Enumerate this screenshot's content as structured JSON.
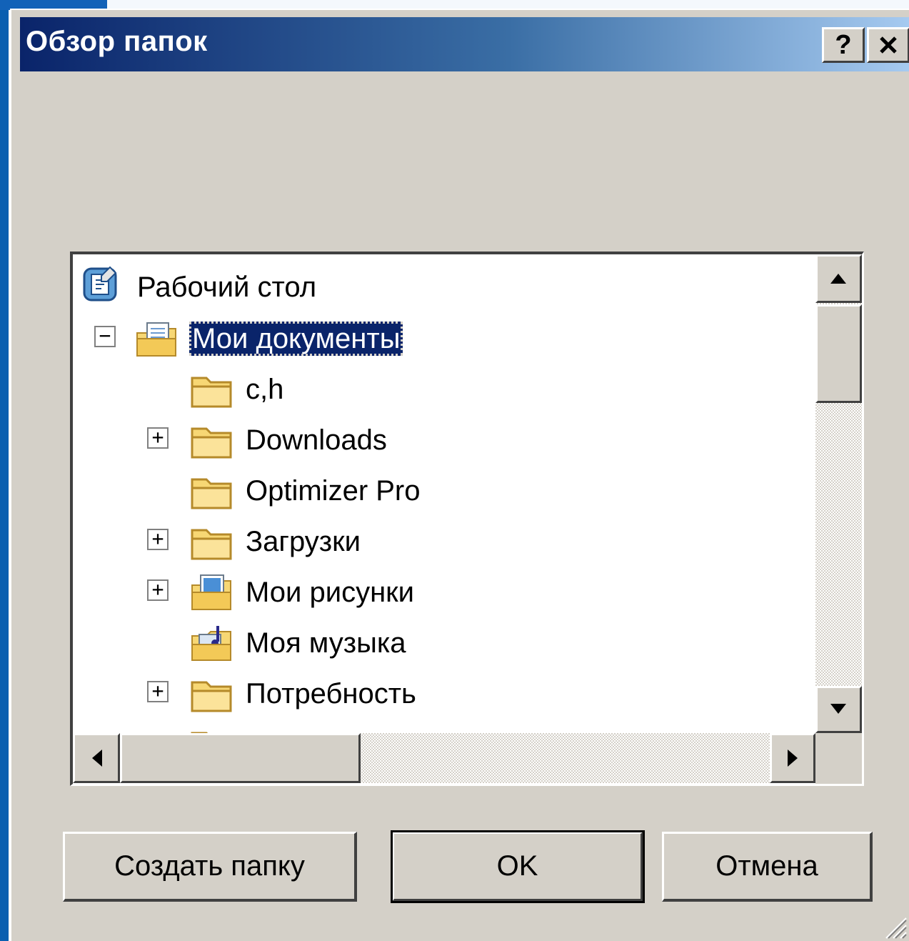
{
  "dialog": {
    "title": "Обзор папок",
    "help_label": "?",
    "close_label": "✕"
  },
  "tree": {
    "root": {
      "label": "Рабочий стол",
      "icon": "desktop-icon"
    },
    "items": [
      {
        "label": "Мои документы",
        "icon": "my-documents-icon",
        "expander": "−",
        "selected": true
      },
      {
        "label": "c,h",
        "icon": "folder-icon",
        "expander": ""
      },
      {
        "label": "Downloads",
        "icon": "folder-icon",
        "expander": "+"
      },
      {
        "label": "Optimizer Pro",
        "icon": "folder-icon",
        "expander": ""
      },
      {
        "label": "Загрузки",
        "icon": "folder-icon",
        "expander": "+"
      },
      {
        "label": "Мои рисунки",
        "icon": "my-pictures-icon",
        "expander": "+"
      },
      {
        "label": "Моя музыка",
        "icon": "my-music-icon",
        "expander": ""
      },
      {
        "label": "Потребность",
        "icon": "folder-icon",
        "expander": "+"
      }
    ]
  },
  "buttons": {
    "new_folder": "Создать папку",
    "ok": "OK",
    "cancel": "Отмена"
  },
  "colors": {
    "titlebar_start": "#0a246a",
    "titlebar_end": "#a6caf0",
    "dialog_face": "#d4d0c8",
    "selection": "#0a246a"
  }
}
